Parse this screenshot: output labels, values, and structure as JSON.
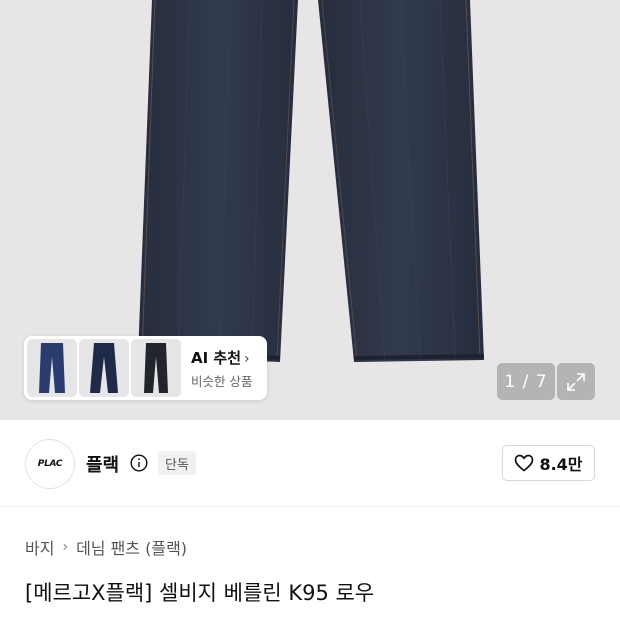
{
  "gallery": {
    "counter": "1 / 7",
    "ai_card": {
      "title": "AI 추천",
      "subtitle": "비슷한 상품"
    }
  },
  "brand": {
    "logo_text": "PLAC",
    "name": "플랙",
    "badge": "단독",
    "likes": "8.4만"
  },
  "breadcrumb": [
    "바지",
    "데님 팬츠 (플랙)"
  ],
  "product": {
    "title": "[메르고X플랙] 셀비지 베를린 K95 로우"
  },
  "icons": [
    "info-icon",
    "heart-icon",
    "expand-icon",
    "chevron-right-icon"
  ],
  "colors": {
    "denim": "#2c3446",
    "background": "#e7e5e6",
    "badge_bg": "#f1f1f1"
  }
}
